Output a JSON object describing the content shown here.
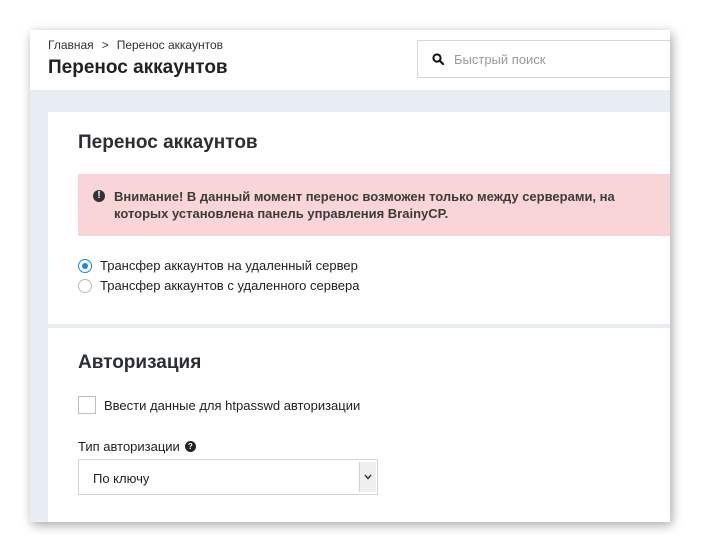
{
  "breadcrumb": {
    "home": "Главная",
    "separator": ">",
    "current": "Перенос аккаунтов"
  },
  "page_title": "Перенос аккаунтов",
  "search": {
    "placeholder": "Быстрый поиск",
    "icon": "search-icon"
  },
  "transfer_section": {
    "title": "Перенос аккаунтов",
    "alert": {
      "icon": "exclamation-circle-icon",
      "line1": "Внимание! В данный момент перенос возможен только между серверами, на",
      "line2": "которых установлена панель управления BrainyCP."
    },
    "options": [
      {
        "label": "Трансфер аккаунтов на удаленный сервер",
        "selected": true
      },
      {
        "label": "Трансфер аккаунтов с удаленного сервера",
        "selected": false
      }
    ]
  },
  "auth_section": {
    "title": "Авторизация",
    "htpasswd_label": "Ввести данные для htpasswd авторизации",
    "htpasswd_checked": false,
    "auth_type_label": "Тип авторизации",
    "auth_type_value": "По ключу"
  },
  "colors": {
    "accent": "#1b87e6",
    "alert_bg": "#f9d5d7",
    "page_bg": "#e8ecf3"
  }
}
